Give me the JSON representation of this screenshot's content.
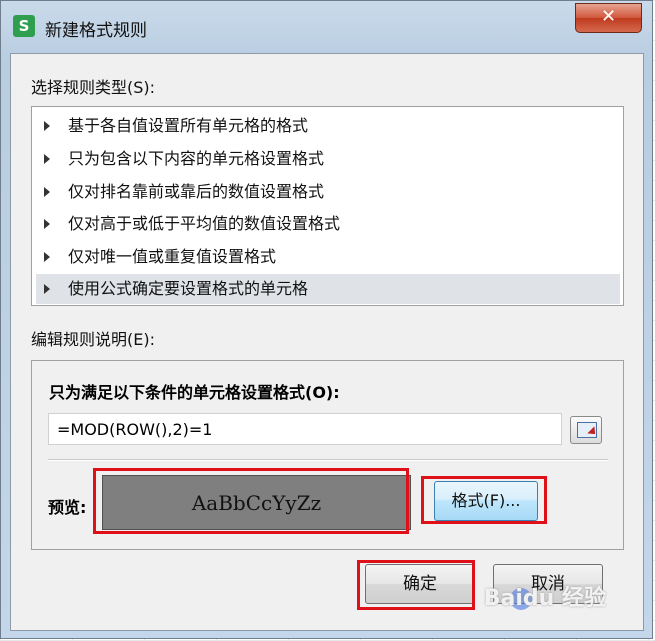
{
  "window": {
    "title": "新建格式规则",
    "app_icon_letter": "S",
    "close_symbol": "✕"
  },
  "rule_type": {
    "label": "选择规则类型(S):",
    "items": [
      {
        "text": "基于各自值设置所有单元格的格式",
        "selected": false
      },
      {
        "text": "只为包含以下内容的单元格设置格式",
        "selected": false
      },
      {
        "text": "仅对排名靠前或靠后的数值设置格式",
        "selected": false
      },
      {
        "text": "仅对高于或低于平均值的数值设置格式",
        "selected": false
      },
      {
        "text": "仅对唯一值或重复值设置格式",
        "selected": false
      },
      {
        "text": "使用公式确定要设置格式的单元格",
        "selected": true
      }
    ]
  },
  "description": {
    "label": "编辑规则说明(E):",
    "condition_label": "只为满足以下条件的单元格设置格式(O):",
    "formula": "=MOD(ROW(),2)=1",
    "preview_label": "预览:",
    "preview_text": "AaBbCcYyZz",
    "preview_bg": "#7f7f7f",
    "format_button": "格式(F)..."
  },
  "buttons": {
    "ok": "确定",
    "cancel": "取消"
  },
  "watermark": "Baidu 经验",
  "highlight_color": "#e0101a"
}
